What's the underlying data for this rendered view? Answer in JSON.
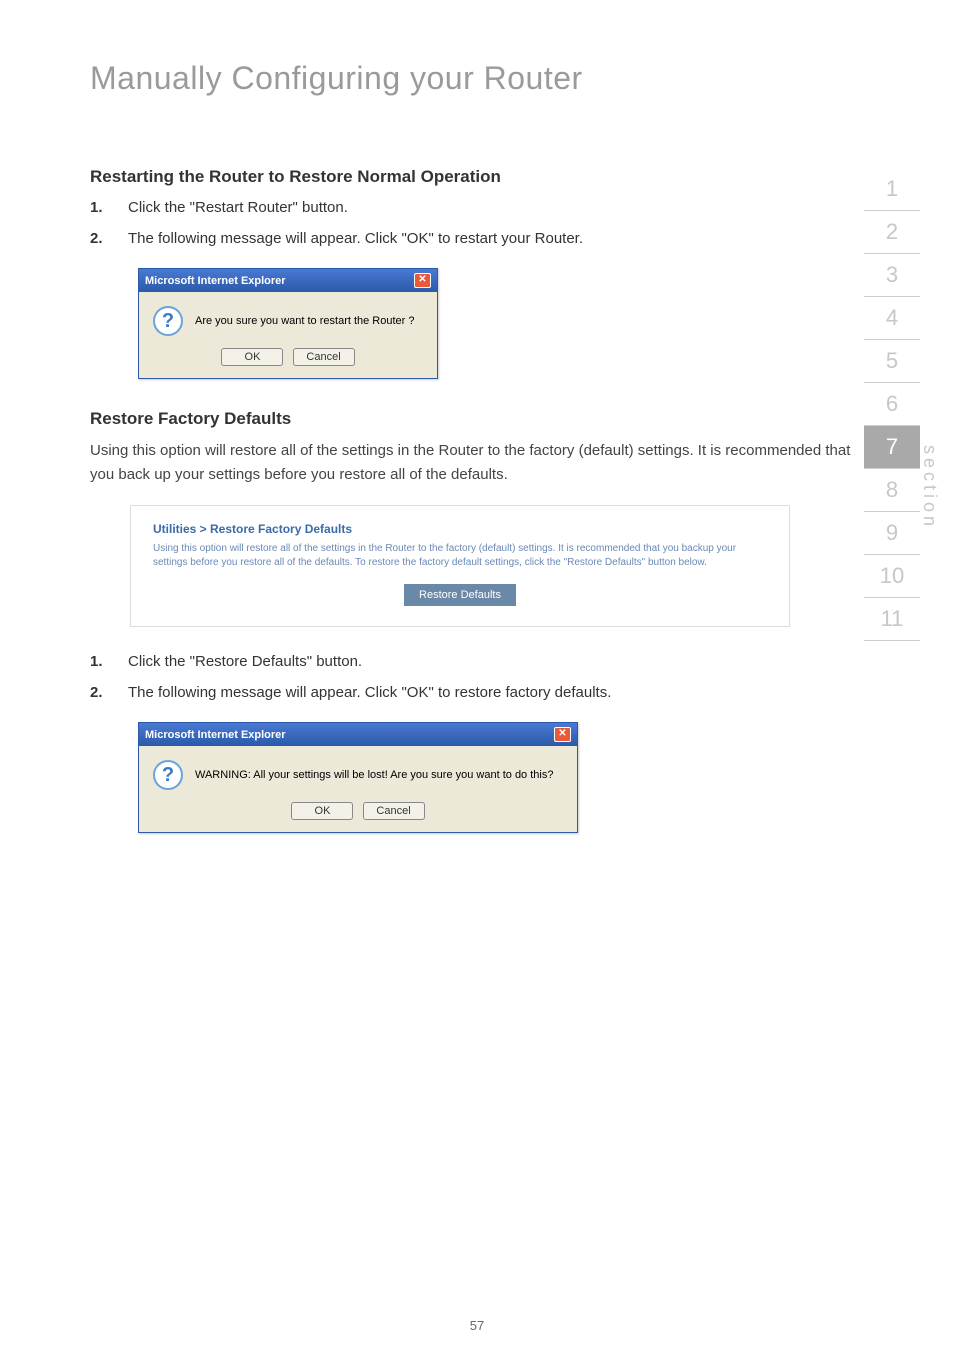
{
  "page_title": "Manually Configuring your Router",
  "section_a": {
    "heading": "Restarting the Router to Restore Normal Operation",
    "step1_num": "1.",
    "step1_text": "Click the \"Restart Router\" button.",
    "step2_num": "2.",
    "step2_text": "The following message will appear. Click \"OK\" to restart your Router."
  },
  "dialog1": {
    "title": "Microsoft Internet Explorer",
    "close_glyph": "✕",
    "icon_glyph": "?",
    "message": "Are you sure you want to restart the Router ?",
    "ok": "OK",
    "cancel": "Cancel"
  },
  "section_b": {
    "heading": "Restore Factory Defaults",
    "body": "Using this option will restore all of the settings in the Router to the factory (default) settings. It is recommended that you back up your settings before you restore all of the defaults."
  },
  "admin_panel": {
    "title": "Utilities > Restore Factory Defaults",
    "desc": "Using this option will restore all of the settings in the Router to the factory (default) settings. It is recommended that you backup your settings before you restore all of the defaults. To restore the factory default settings, click the \"Restore Defaults\" button below.",
    "button": "Restore Defaults"
  },
  "section_c": {
    "step1_num": "1.",
    "step1_text": "Click the \"Restore Defaults\" button.",
    "step2_num": "2.",
    "step2_text": "The following message will appear. Click \"OK\" to restore factory defaults."
  },
  "dialog2": {
    "title": "Microsoft Internet Explorer",
    "close_glyph": "✕",
    "icon_glyph": "?",
    "message": "WARNING: All your settings will be lost! Are you sure you want to do this?",
    "ok": "OK",
    "cancel": "Cancel"
  },
  "side_nav": {
    "items": [
      "1",
      "2",
      "3",
      "4",
      "5",
      "6",
      "7",
      "8",
      "9",
      "10",
      "11"
    ],
    "active_index": 6,
    "label": "section"
  },
  "page_number": "57"
}
